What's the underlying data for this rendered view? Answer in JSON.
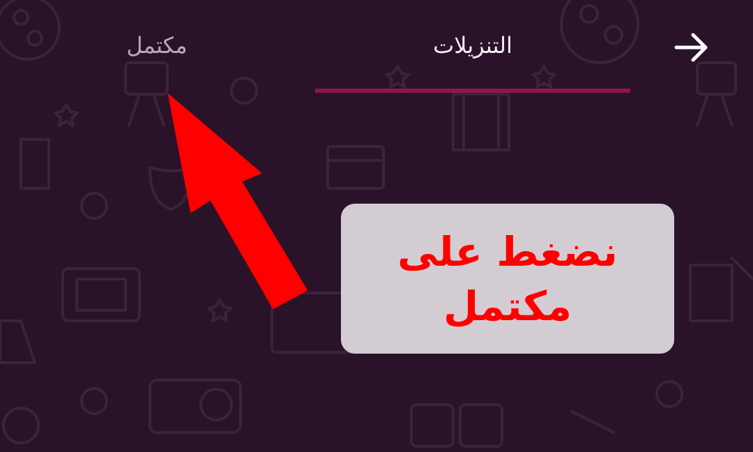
{
  "header": {
    "back_icon": "arrow-right-icon",
    "tabs": [
      {
        "label": "التنزيلات",
        "selected": true
      },
      {
        "label": "مكتمل",
        "selected": false
      }
    ]
  },
  "annotation": {
    "callout_text": "نضغط على مكتمل",
    "callout_color": "#ff0000",
    "arrow_color": "#ff0000",
    "arrow_icon": "red-arrow-pointer-icon"
  },
  "theme": {
    "background": "#2a1328",
    "tab_indicator": "#8a1a45"
  }
}
